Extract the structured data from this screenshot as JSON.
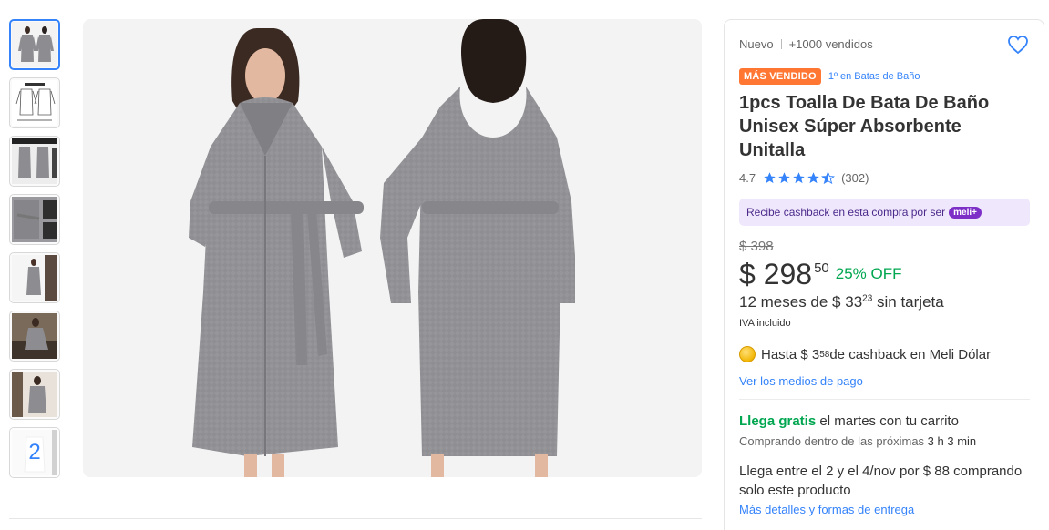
{
  "gallery": {
    "thumbnails": [
      {
        "name": "thumb-front-back"
      },
      {
        "name": "thumb-size-chart"
      },
      {
        "name": "thumb-detail-banner"
      },
      {
        "name": "thumb-fabric-closeup"
      },
      {
        "name": "thumb-model-full"
      },
      {
        "name": "thumb-model-sitting"
      },
      {
        "name": "thumb-model-pose"
      },
      {
        "name": "thumb-more"
      }
    ],
    "more_count": "2",
    "robe_color": "#8d8d91",
    "background_color": "#f3f3f3"
  },
  "product": {
    "condition": "Nuevo",
    "sold": "+1000 vendidos",
    "badge": "MÁS VENDIDO",
    "badge_color": "#ff7733",
    "category_rank": "1º en Batas de Baño",
    "title": "1pcs Toalla De Bata De Baño Unisex Súper Absorbente Unitalla",
    "rating": "4.7",
    "stars": 4.7,
    "reviews": "(302)",
    "cashback_banner": "Recibe cashback en esta compra por ser",
    "cashback_pill": "meli+",
    "old_price": "$ 398",
    "price": "$ 298",
    "price_cents": "50",
    "discount": "25% OFF",
    "installments_prefix": "12 meses de $ 33",
    "installments_cents": "23",
    "installments_suffix": " sin tarjeta",
    "iva": "IVA incluido",
    "meli_dolar_prefix": "Hasta $ 3",
    "meli_dolar_cents": "58",
    "meli_dolar_suffix": " de cashback en Meli Dólar",
    "payment_link": "Ver los medios de pago"
  },
  "shipping": {
    "free_label": "Llega gratis",
    "free_suffix": " el martes con tu carrito",
    "countdown_prefix": "Comprando dentro de las próximas ",
    "countdown_time": "3 h 3 min",
    "alt_delivery": "Llega entre el 2 y el 4/nov por $ 88 comprando solo este producto",
    "details_link": "Más detalles y formas de entrega"
  },
  "colors": {
    "accent": "#3483fa",
    "green": "#00a650",
    "star": "#3483fa"
  }
}
